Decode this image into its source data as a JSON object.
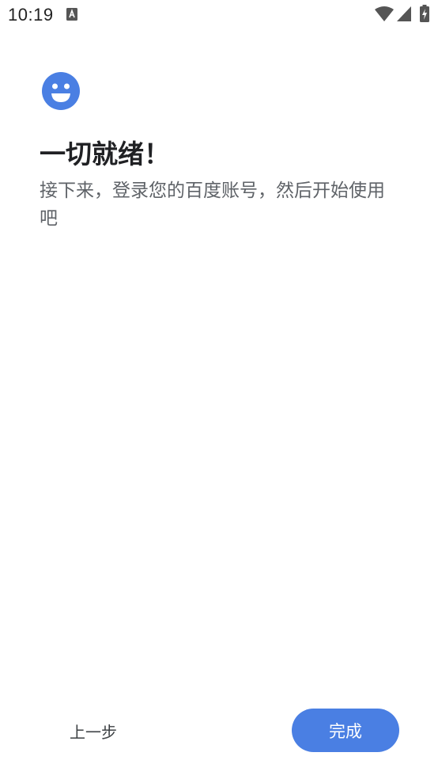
{
  "status_bar": {
    "time": "10:19",
    "icons": [
      "notification-a-icon",
      "wifi-icon",
      "cell-signal-icon",
      "battery-charging-icon"
    ]
  },
  "main": {
    "icon": "smile-icon",
    "title": "一切就绪！",
    "subtitle": "接下来，登录您的百度账号，然后开始使用吧"
  },
  "footer": {
    "back_label": "上一步",
    "done_label": "完成"
  },
  "colors": {
    "accent": "#4a7fe3",
    "title_text": "#202124",
    "body_text": "#5f6368"
  }
}
